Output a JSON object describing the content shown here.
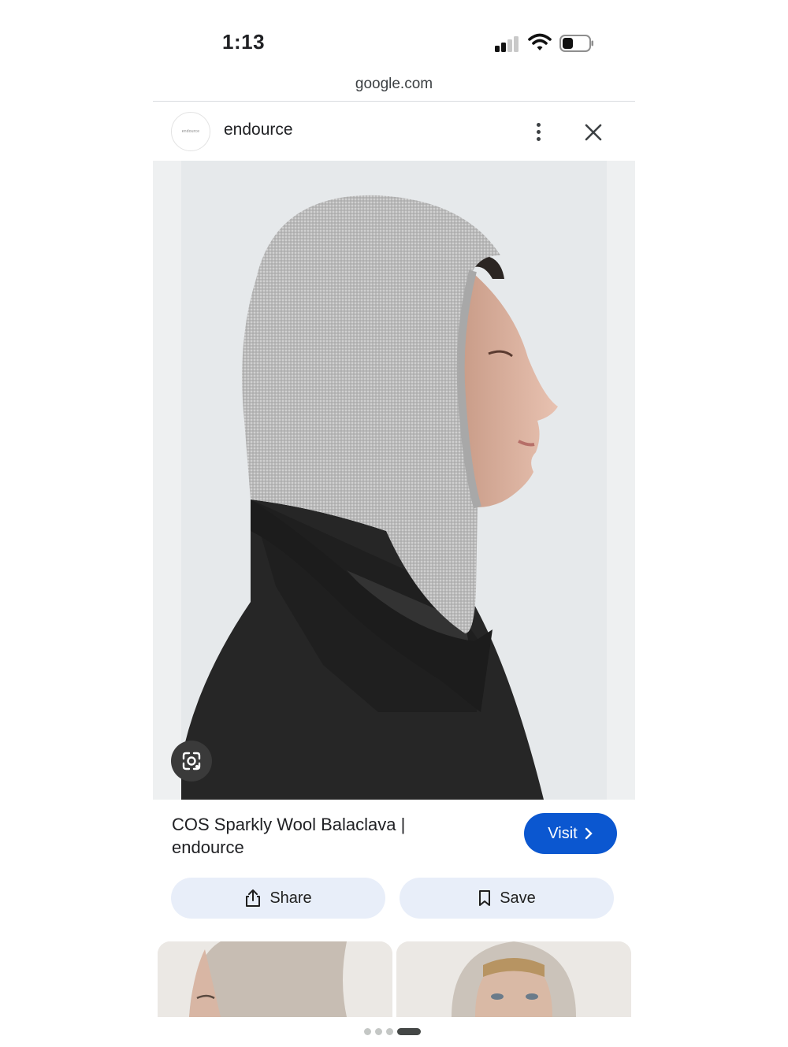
{
  "status_bar": {
    "time": "1:13"
  },
  "browser": {
    "url": "google.com"
  },
  "source": {
    "name": "endource",
    "logo_text": "endource"
  },
  "result": {
    "title_line1": "COS Sparkly Wool Balaclava |",
    "title_line2": "endource",
    "visit_label": "Visit"
  },
  "actions": {
    "share_label": "Share",
    "save_label": "Save"
  },
  "icons": {
    "more": "more-vert-icon",
    "close": "close-icon",
    "lens": "google-lens-icon",
    "share": "share-icon",
    "save": "bookmark-icon",
    "visit": "chevron-right-icon"
  },
  "colors": {
    "visit_button": "#0b57d0",
    "action_button": "#e8eef9"
  }
}
